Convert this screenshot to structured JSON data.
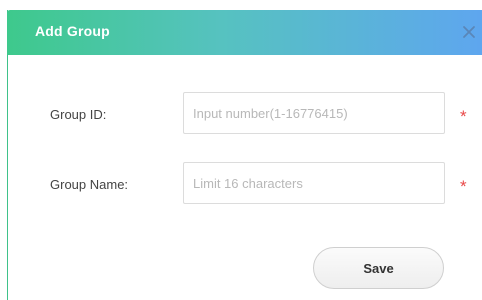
{
  "dialog": {
    "title": "Add Group",
    "close_icon": "close-icon",
    "fields": [
      {
        "label": "Group ID:",
        "value": "",
        "placeholder": "Input number(1-16776415)",
        "required_mark": "*"
      },
      {
        "label": "Group Name:",
        "value": "",
        "placeholder": "Limit 16 characters",
        "required_mark": "*"
      }
    ],
    "save_label": "Save"
  },
  "colors": {
    "header_gradient_start": "#3ec98c",
    "header_gradient_end": "#5ea6ef",
    "required": "#e84848"
  }
}
